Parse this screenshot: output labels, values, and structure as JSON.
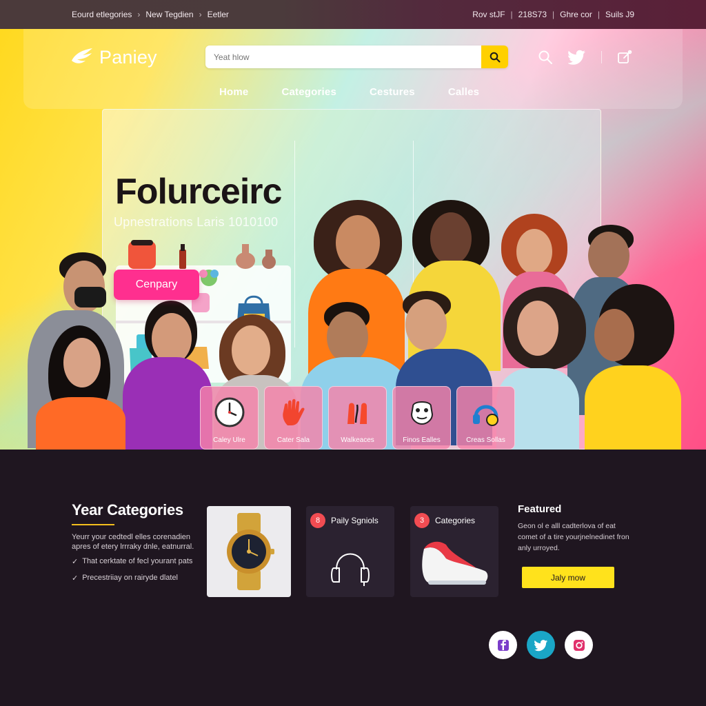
{
  "topbar": {
    "left_items": [
      "Eourd etlegories",
      "New Tegdien",
      "Eetler"
    ],
    "right_items": [
      "Rov stJF",
      "218S73",
      "Ghre cor",
      "Suils J9"
    ]
  },
  "header": {
    "logo_text": "Paniey",
    "search_placeholder": "Yeat hlow",
    "nav": [
      "Home",
      "Categories",
      "Cestures",
      "Calles"
    ]
  },
  "hero": {
    "title": "Folurceirc",
    "subtitle": "Upnestrations Laris 1010100",
    "cta_label": "Cenpary",
    "tiles": [
      {
        "label": "Caley Ulre",
        "icon": "clock-icon"
      },
      {
        "label": "Cater Sala",
        "icon": "hand-icon"
      },
      {
        "label": "Walkeaces",
        "icon": "gloves-icon"
      },
      {
        "label": "Finos Ealles",
        "icon": "figure-icon"
      },
      {
        "label": "Creas Sollas",
        "icon": "headphones-icon"
      }
    ]
  },
  "categories_section": {
    "title": "Year Categories",
    "description": "Yeurr your cedtedl elles corenadien apres of etery lrrraky dnle, eatnurral.",
    "checks": [
      "That cerktate of fecl yourant pats",
      "Precestriiay on rairyde dlatel"
    ],
    "cards": [
      {
        "badge": "8",
        "title": "Paily Sgniols",
        "icon": "headphones-icon"
      },
      {
        "badge": "3",
        "title": "Categories",
        "icon": "shoe-icon"
      }
    ]
  },
  "featured": {
    "title": "Featured",
    "description": "Geon ol e alll cadterlova of eat comet of a tire yourjnelnedinet fron anly urroyed.",
    "button_label": "Jaly mow"
  },
  "social": [
    {
      "icon": "facebook-icon",
      "color": "#7a3cc9"
    },
    {
      "icon": "twitter-icon",
      "color": "#1aa6c6"
    },
    {
      "icon": "instagram-icon",
      "color": "#e1306c"
    }
  ],
  "colors": {
    "accent_pink": "#ff2f8f",
    "accent_yellow": "#ffe21c",
    "dark_bg": "#1f1620"
  }
}
